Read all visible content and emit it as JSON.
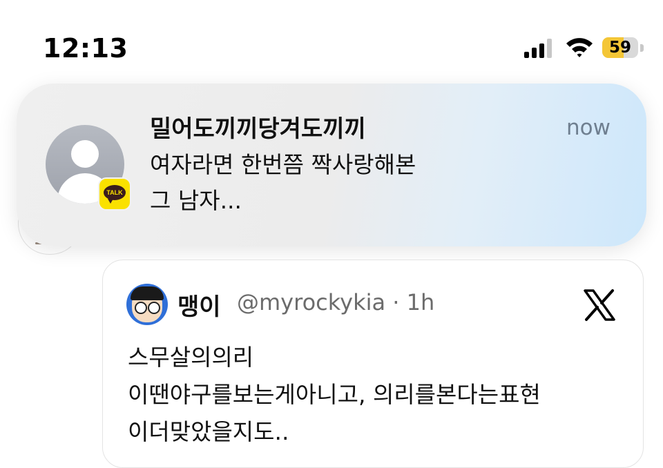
{
  "status_bar": {
    "time": "12:13",
    "battery_level": "59",
    "battery_fraction": 0.59,
    "signal_icon": "cellular-signal-icon",
    "wifi_icon": "wifi-icon"
  },
  "notification": {
    "app_icon": "kakaotalk-icon",
    "app_badge_text": "TALK",
    "title": "밀어도끼끼당겨도끼끼",
    "time": "now",
    "body_line_1": "여자라면 한번쯤 짝사랑해본",
    "body_line_2": "그 남자..."
  },
  "tweet": {
    "author_name": "맹이",
    "handle_time": "@myrockykia · 1h",
    "logo": "x-logo-icon",
    "text_lines": [
      "스무살의의리",
      "이땐야구를보는게아니고, 의리를본다는표현",
      "이더맞았을지도.."
    ]
  },
  "colors": {
    "battery_accent": "#f4c636",
    "kakao_yellow": "#fae100",
    "notif_time": "#6f7f90",
    "tweet_handle": "#6b6b6b"
  }
}
